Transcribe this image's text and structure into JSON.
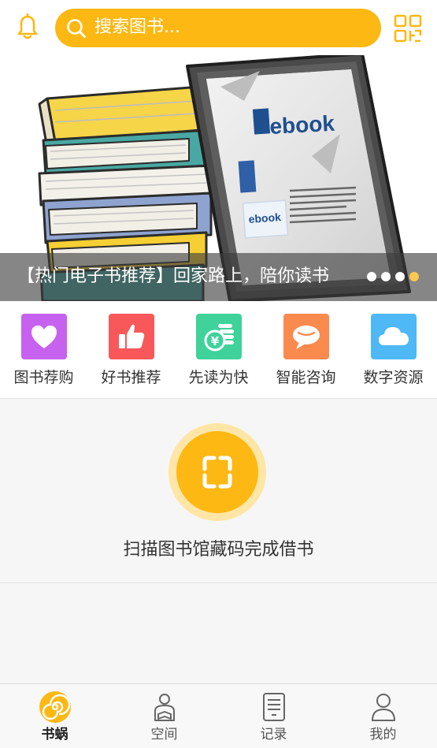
{
  "header": {
    "search_placeholder": "搜索图书...",
    "icons": [
      "bell-icon",
      "search-icon",
      "qr-scan-icon"
    ],
    "accent_color": "#fdb813"
  },
  "banner": {
    "caption": "【热门电子书推荐】回家路上，陪你读书",
    "ebook_logo": "ebook",
    "slides": 4,
    "active_slide": 4
  },
  "quick_links": [
    {
      "label": "图书荐购",
      "icon": "heart-icon",
      "color": "#c761f0"
    },
    {
      "label": "好书推荐",
      "icon": "thumbs-up-icon",
      "color": "#f8585a"
    },
    {
      "label": "先读为快",
      "icon": "coins-icon",
      "color": "#3fd29b"
    },
    {
      "label": "智能咨询",
      "icon": "chat-icon",
      "color": "#fb8a4f"
    },
    {
      "label": "数字资源",
      "icon": "cloud-icon",
      "color": "#4fb8f6"
    }
  ],
  "scan": {
    "label": "扫描图书馆藏码完成借书"
  },
  "tabbar": {
    "items": [
      {
        "label": "书蜗",
        "icon": "snail-logo-icon",
        "active": true
      },
      {
        "label": "空间",
        "icon": "person-reading-icon",
        "active": false
      },
      {
        "label": "记录",
        "icon": "document-icon",
        "active": false
      },
      {
        "label": "我的",
        "icon": "user-icon",
        "active": false
      }
    ]
  }
}
